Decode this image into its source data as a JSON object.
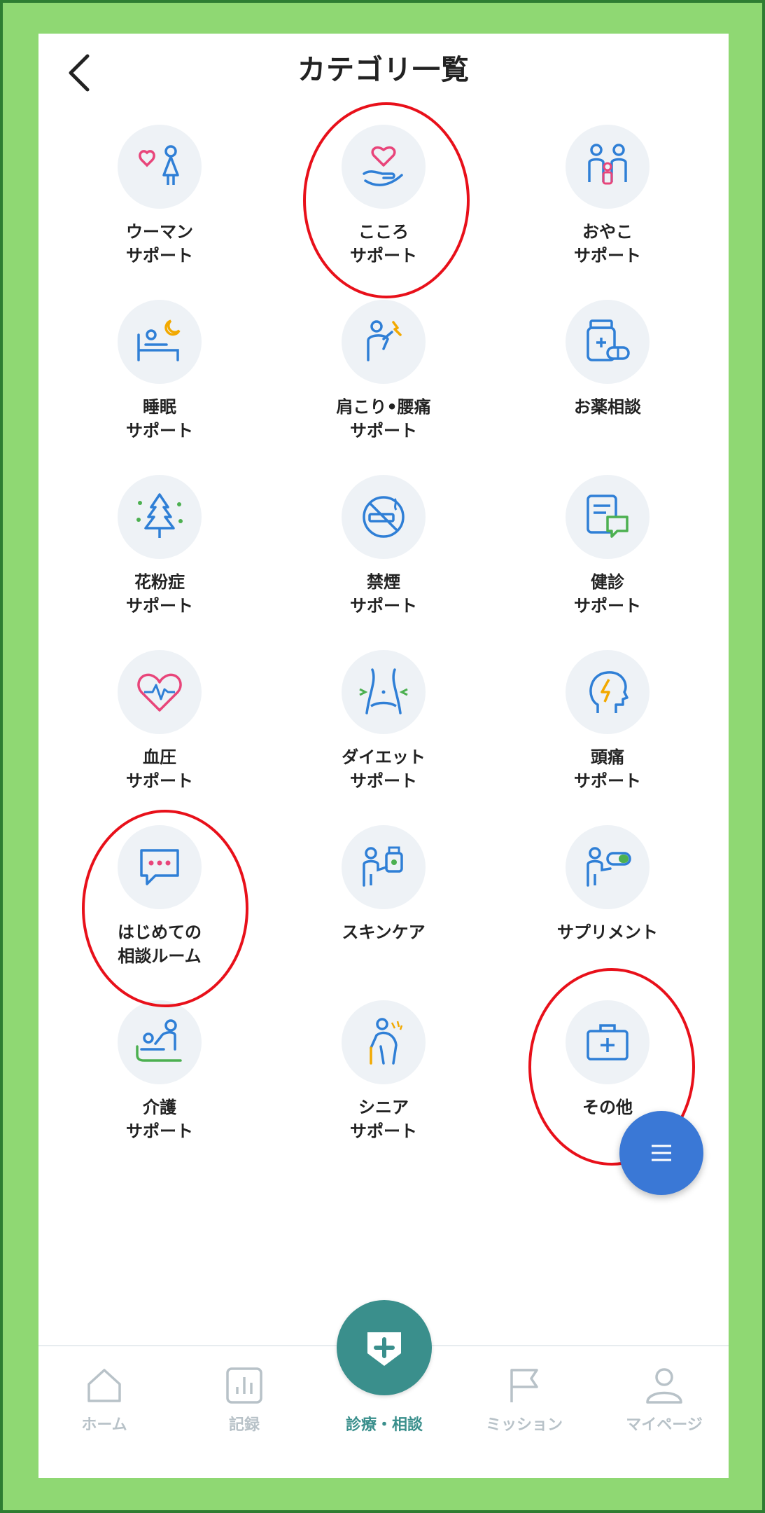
{
  "header": {
    "title": "カテゴリ一覧"
  },
  "categories": [
    {
      "label": "ウーマン\nサポート",
      "icon": "woman-heart-icon"
    },
    {
      "label": "こころ\nサポート",
      "icon": "hand-heart-icon"
    },
    {
      "label": "おやこ\nサポート",
      "icon": "family-icon"
    },
    {
      "label": "睡眠\nサポート",
      "icon": "sleep-bed-icon"
    },
    {
      "label": "肩こり•腰痛\nサポート",
      "icon": "shoulder-pain-icon"
    },
    {
      "label": "お薬相談",
      "icon": "medicine-bottle-icon"
    },
    {
      "label": "花粉症\nサポート",
      "icon": "pollen-tree-icon"
    },
    {
      "label": "禁煙\nサポート",
      "icon": "no-smoking-icon"
    },
    {
      "label": "健診\nサポート",
      "icon": "checkup-clipboard-icon"
    },
    {
      "label": "血圧\nサポート",
      "icon": "heart-pulse-icon"
    },
    {
      "label": "ダイエット\nサポート",
      "icon": "waist-icon"
    },
    {
      "label": "頭痛\nサポート",
      "icon": "head-lightning-icon"
    },
    {
      "label": "はじめての\n相談ルーム",
      "icon": "chat-bubble-icon"
    },
    {
      "label": "スキンケア",
      "icon": "skincare-icon"
    },
    {
      "label": "サプリメント",
      "icon": "supplement-icon"
    },
    {
      "label": "介護\nサポート",
      "icon": "caregiving-icon"
    },
    {
      "label": "シニア\nサポート",
      "icon": "senior-icon"
    },
    {
      "label": "その他",
      "icon": "first-aid-kit-icon"
    }
  ],
  "nav": {
    "home": "ホーム",
    "record": "記録",
    "consult": "診療・相談",
    "mission": "ミッション",
    "mypage": "マイページ"
  },
  "colors": {
    "frame": "#8fd873",
    "annotation": "#e8101a",
    "accent_teal": "#3a8f8c",
    "fab_blue": "#3a78d6",
    "icon_blue": "#2f7fd6",
    "icon_pink": "#e8457a"
  }
}
